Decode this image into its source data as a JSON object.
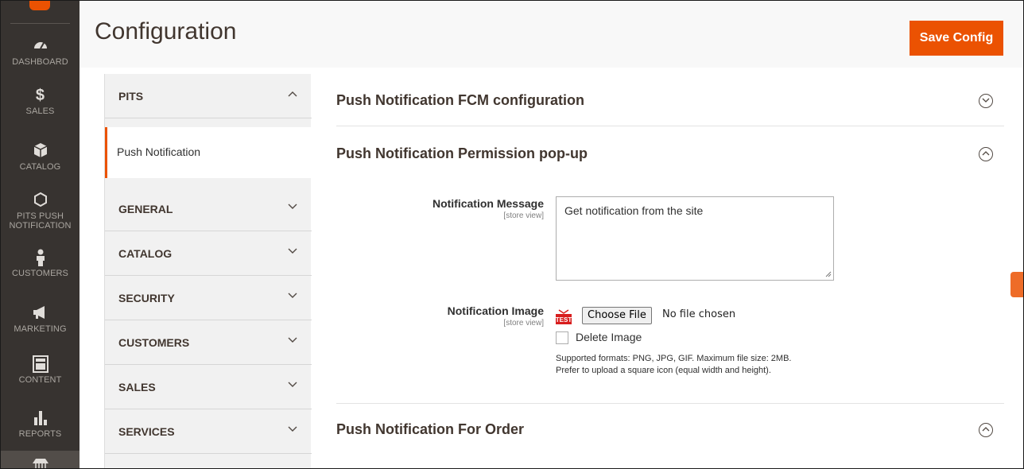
{
  "nav": {
    "items": [
      {
        "label": "DASHBOARD",
        "icon": "dashboard-icon"
      },
      {
        "label": "SALES",
        "icon": "dollar-icon"
      },
      {
        "label": "CATALOG",
        "icon": "box-icon"
      },
      {
        "label": "PITS PUSH NOTIFICATION",
        "line1": "PITS PUSH",
        "line2": "NOTIFICATION",
        "icon": "hexagon-icon"
      },
      {
        "label": "CUSTOMERS",
        "icon": "person-icon"
      },
      {
        "label": "MARKETING",
        "icon": "megaphone-icon"
      },
      {
        "label": "CONTENT",
        "icon": "layout-icon"
      },
      {
        "label": "REPORTS",
        "icon": "bar-chart-icon"
      },
      {
        "label": "",
        "icon": "store-icon"
      }
    ]
  },
  "header": {
    "title": "Configuration",
    "save_label": "Save Config"
  },
  "tabs": {
    "active_group": "PITS",
    "active_item": "Push Notification",
    "groups": [
      "GENERAL",
      "CATALOG",
      "SECURITY",
      "CUSTOMERS",
      "SALES",
      "SERVICES"
    ]
  },
  "sections": {
    "fcm": {
      "title": "Push Notification FCM configuration"
    },
    "popup": {
      "title": "Push Notification Permission pop-up"
    },
    "order": {
      "title": "Push Notification For Order"
    }
  },
  "fields": {
    "message": {
      "label": "Notification Message",
      "scope": "[store view]",
      "value": "Get notification from the site"
    },
    "image": {
      "label": "Notification Image",
      "scope": "[store view]",
      "choose_label": "Choose File",
      "no_file": "No file chosen",
      "delete_label": "Delete Image",
      "note_line1": "Supported formats: PNG, JPG, GIF. Maximum file size: 2MB.",
      "note_line2": "Prefer to upload a square icon (equal width and height).",
      "thumb_text": "TEST"
    }
  },
  "colors": {
    "accent": "#eb5202",
    "nav_bg": "#373330",
    "tabs_bg": "#f1f1f1"
  }
}
